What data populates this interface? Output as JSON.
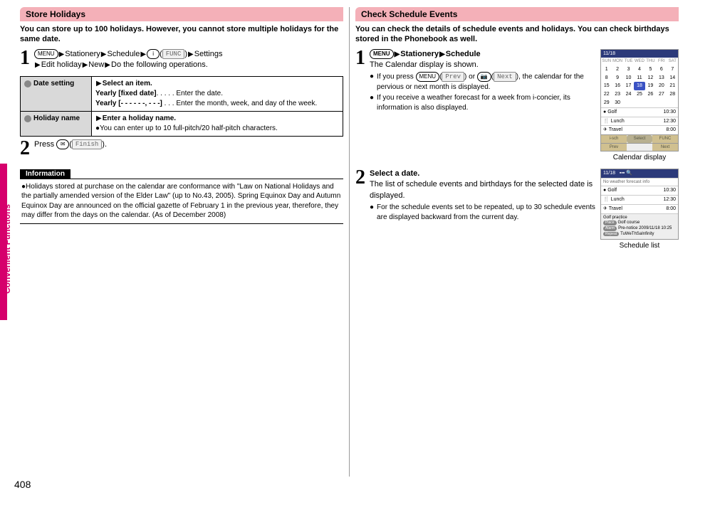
{
  "page_number": "408",
  "side_tab": "Convenient Functions",
  "left": {
    "section_title": "Store Holidays",
    "intro": "You can store up to 100 holidays. However, you cannot store multiple holidays for the same date.",
    "step1": {
      "menu_key": "MENU",
      "nav1": "Stationery",
      "nav2": "Schedule",
      "i_key": "i",
      "func_label": "FUNC",
      "nav3": "Settings",
      "nav4": "Edit holiday",
      "nav5": "New",
      "nav6": "Do the following operations."
    },
    "table": [
      {
        "label": "Date setting",
        "body_lead": "Select an item.",
        "line1_key": "Yearly [fixed date]",
        "line1_val": ". . . . . Enter the date.",
        "line2_key": "Yearly [- - - - - -, - - -]",
        "line2_val": " . . . Enter the month, week, and day of the week."
      },
      {
        "label": "Holiday name",
        "body_lead": "Enter a holiday name.",
        "note": "You can enter up to 10 full-pitch/20 half-pitch characters."
      }
    ],
    "step2": {
      "text_before": "Press ",
      "key": "✉",
      "soft_label": "Finish",
      "text_after": "."
    },
    "info_title": "Information",
    "info_body": "Holidays stored at purchase on the calendar are conformance with \"Law on National Holidays and the partially amended version of the Elder Law\" (up to No.43, 2005). Spring Equinox Day and Autumn Equinox Day are announced on the official gazette of February 1 in the previous year, therefore, they may differ from the days on the calendar. (As of December 2008)"
  },
  "right": {
    "section_title": "Check Schedule Events",
    "intro": "You can check the details of schedule events and holidays. You can check birthdays stored in the Phonebook as well.",
    "step1": {
      "menu_key": "MENU",
      "nav1": "Stationery",
      "nav2": "Schedule",
      "desc": "The Calendar display is shown.",
      "bullet1_a": "If you press ",
      "bullet1_key1": "MENU",
      "bullet1_label1": "Prev",
      "bullet1_b": " or ",
      "bullet1_key2": "📷",
      "bullet1_label2": "Next",
      "bullet1_c": ", the calendar for the pervious or next month is displayed.",
      "bullet2": "If you receive a weather forecast for a week from i-concier, its information is also displayed."
    },
    "calendar": {
      "title": "11/18",
      "weekdays": [
        "SUN",
        "MON",
        "TUE",
        "WED",
        "THU",
        "FRI",
        "SAT"
      ],
      "rows": [
        [
          "1",
          "2",
          "3",
          "4",
          "5",
          "6",
          "7"
        ],
        [
          "8",
          "9",
          "10",
          "11",
          "12",
          "13",
          "14"
        ],
        [
          "15",
          "16",
          "17",
          "18",
          "19",
          "20",
          "21"
        ],
        [
          "22",
          "23",
          "24",
          "25",
          "26",
          "27",
          "28"
        ],
        [
          "29",
          "30",
          "",
          "",
          "",
          "",
          ""
        ]
      ],
      "selected": "18",
      "events": [
        {
          "name": "Golf",
          "time": "10:30"
        },
        {
          "name": "Lunch",
          "time": "12:30"
        },
        {
          "name": "Travel",
          "time": "8:00"
        }
      ],
      "softkeys": {
        "l1": "i-sch",
        "c": "Select",
        "r1": "FUNC",
        "l2": "Prev",
        "r2": "Next"
      },
      "caption": "Calendar display"
    },
    "step2": {
      "title": "Select a date.",
      "desc": "The list of schedule events and birthdays for the selected date is displayed.",
      "bullet": "For the schedule events set to be repeated, up to 30 schedule events are displayed backward from the current day."
    },
    "schedule_list": {
      "title": "11/18",
      "header": "No weather forecast info",
      "rows": [
        {
          "name": "Golf",
          "time": "10:30"
        },
        {
          "name": "Lunch",
          "time": "12:30"
        },
        {
          "name": "Travel",
          "time": "8:00"
        }
      ],
      "footer_line1": "Golf practice",
      "footer_tag1": "Place",
      "footer_val1": "Golf course",
      "footer_tag2": "Alarm",
      "footer_val2": "Pre-notice 2009/11/18 10:25",
      "footer_tag3": "Repeat",
      "footer_val3": "TuWeThSaInfinity",
      "caption": "Schedule list"
    }
  }
}
